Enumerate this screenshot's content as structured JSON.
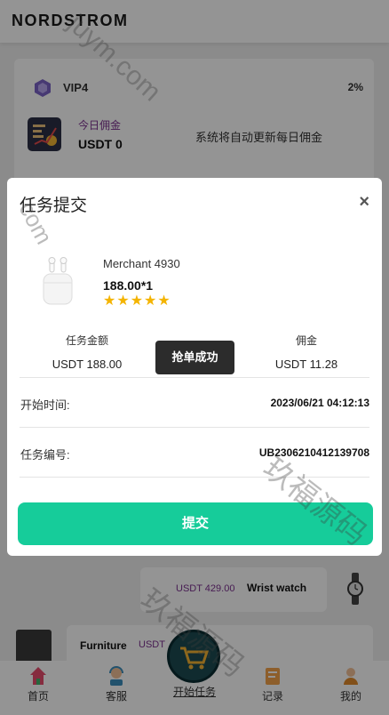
{
  "header": {
    "brand": "NORDSTROM"
  },
  "vip_card": {
    "level": "VIP4",
    "percent": "2%",
    "commission_label": "今日佣金",
    "commission_value": "USDT 0",
    "commission_note": "系统将自动更新每日佣金"
  },
  "background_orders": [
    {
      "price": "USDT 429.00",
      "name": "Wrist watch",
      "icon": "wristwatch-icon"
    },
    {
      "price": "USDT",
      "name": "Furniture",
      "icon": "furniture-icon"
    }
  ],
  "modal": {
    "title": "任务提交",
    "close": "×",
    "merchant": "Merchant 4930",
    "price_qty": "188.00*1",
    "rating": 5,
    "task_amount_label": "任务金额",
    "task_amount_value": "USDT  188.00",
    "commission_label": "佣金",
    "commission_value": "USDT  11.28",
    "toast": "抢单成功",
    "start_time_label": "开始时间:",
    "start_time_value": "2023/06/21 04:12:13",
    "task_no_label": "任务编号:",
    "task_no_value": "UB2306210412139708",
    "submit_label": "提交"
  },
  "tabbar": {
    "items": [
      {
        "label": "首页",
        "icon": "home-icon"
      },
      {
        "label": "客服",
        "icon": "customer-service-icon"
      },
      {
        "label": "开始任务",
        "icon": "cart-icon"
      },
      {
        "label": "记录",
        "icon": "records-icon"
      },
      {
        "label": "我的",
        "icon": "profile-icon"
      }
    ]
  },
  "watermarks": {
    "a": "juym.com",
    "b": "com",
    "c": "玖福源码",
    "d": "玖福源码"
  },
  "colors": {
    "accent": "#16cc9a",
    "purple_text": "#7a2f8e",
    "toast_bg": "#2c2c2c",
    "overlay": "rgba(0,0,0,0.42)"
  }
}
